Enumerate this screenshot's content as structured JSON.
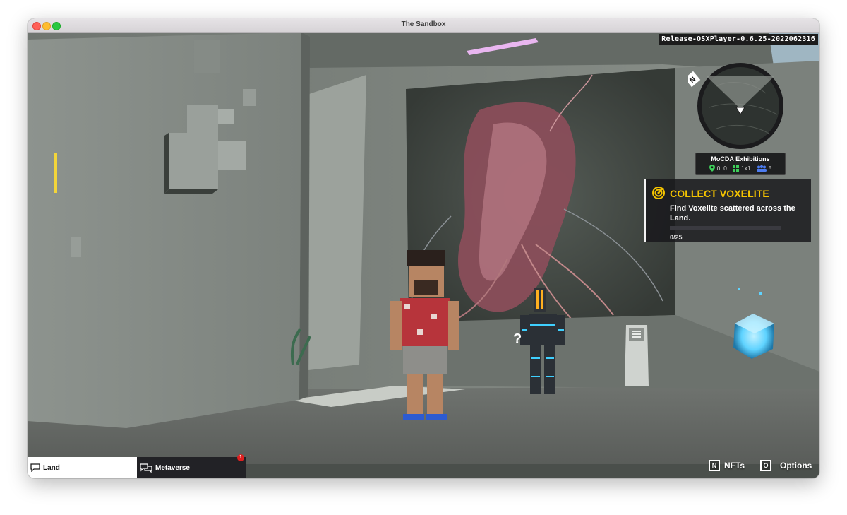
{
  "window": {
    "title": "The Sandbox"
  },
  "hud": {
    "version": "Release-OSXPlayer-0.6.25-2022062316",
    "minimap": {
      "location_name": "MoCDA Exhibitions",
      "coords": "0, 0",
      "size": "1x1",
      "players": "5",
      "north_label": "N"
    },
    "quest": {
      "title": "COLLECT VOXELITE",
      "description": "Find Voxelite scattered across the Land.",
      "progress_text": "0/25",
      "progress_fraction": 0
    },
    "chat": {
      "tabs": [
        {
          "label": "Land",
          "active": true
        },
        {
          "label": "Metaverse",
          "active": false,
          "badge": "1"
        }
      ]
    },
    "buttons": [
      {
        "key": "N",
        "label": "NFTs"
      },
      {
        "key": "O",
        "label": "Options"
      }
    ],
    "npc_marker": "?"
  },
  "colors": {
    "quest_accent": "#f5c400",
    "alert": "#f3d53a",
    "voxelite": "#5fd3ff",
    "robot_glow": "#3fd0ff"
  }
}
